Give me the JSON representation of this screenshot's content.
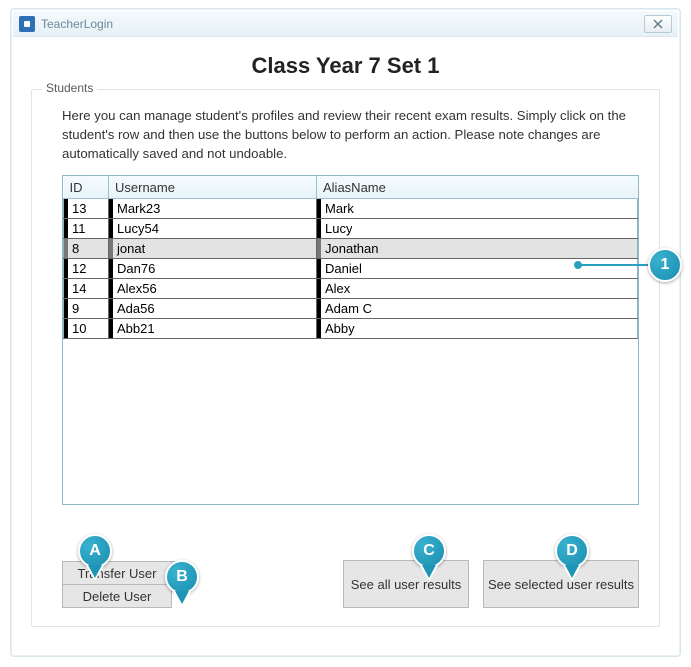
{
  "window": {
    "title": "TeacherLogin"
  },
  "page": {
    "heading": "Class Year 7 Set 1"
  },
  "group": {
    "legend": "Students",
    "instructions": "Here you can manage student's profiles and review their recent exam results. Simply click on the student's row and then use the buttons below to perform an action. Please note changes are automatically saved and not undoable."
  },
  "table": {
    "columns": {
      "id": "ID",
      "username": "Username",
      "alias": "AliasName"
    },
    "rows": [
      {
        "id": "13",
        "username": "Mark23",
        "alias": "Mark",
        "selected": false
      },
      {
        "id": "11",
        "username": "Lucy54",
        "alias": "Lucy",
        "selected": false
      },
      {
        "id": "8",
        "username": "jonat",
        "alias": "Jonathan",
        "selected": true
      },
      {
        "id": "12",
        "username": "Dan76",
        "alias": "Daniel",
        "selected": false
      },
      {
        "id": "14",
        "username": "Alex56",
        "alias": "Alex",
        "selected": false
      },
      {
        "id": "9",
        "username": "Ada56",
        "alias": "Adam C",
        "selected": false
      },
      {
        "id": "10",
        "username": "Abb21",
        "alias": "Abby",
        "selected": false
      }
    ]
  },
  "buttons": {
    "transfer": "Transfer User",
    "delete": "Delete User",
    "see_all": "See all user results",
    "see_selected": "See selected user results"
  },
  "callouts": {
    "one": "1",
    "a": "A",
    "b": "B",
    "c": "C",
    "d": "D"
  }
}
